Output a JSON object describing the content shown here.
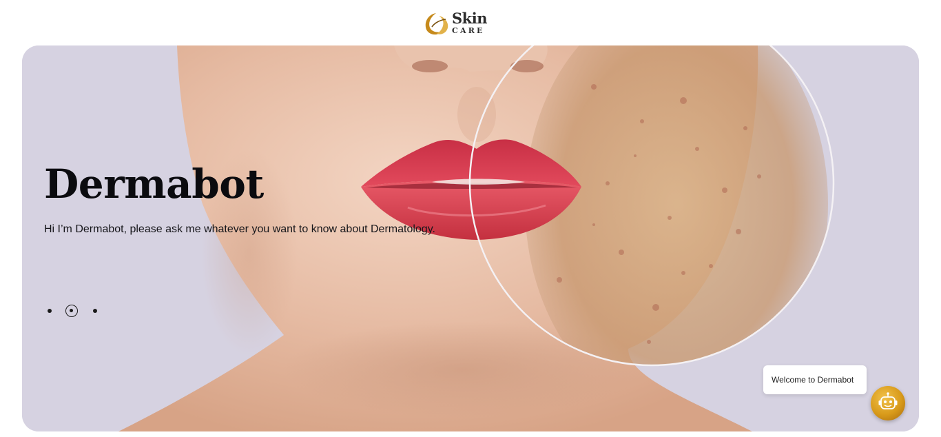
{
  "header": {
    "logo": {
      "line1": "Skin",
      "line2": "CARE"
    }
  },
  "hero": {
    "title": "Dermabot",
    "subtitle": "Hi I’m Dermabot, please ask me whatever you want to know about Dermatology.",
    "slides": {
      "count": 3,
      "active_index": 2
    }
  },
  "chat": {
    "bubble_text": "Welcome to Dermabot"
  },
  "colors": {
    "hero_background": "#d6d2e1",
    "lips": "#d8414f",
    "bot_accent": "#d89a1a",
    "title_text": "#0b0b0f"
  },
  "icons": {
    "logo_mark": "leaf-swirl-icon",
    "bot_button": "robot-icon",
    "slider_dots": "dot-icon"
  }
}
